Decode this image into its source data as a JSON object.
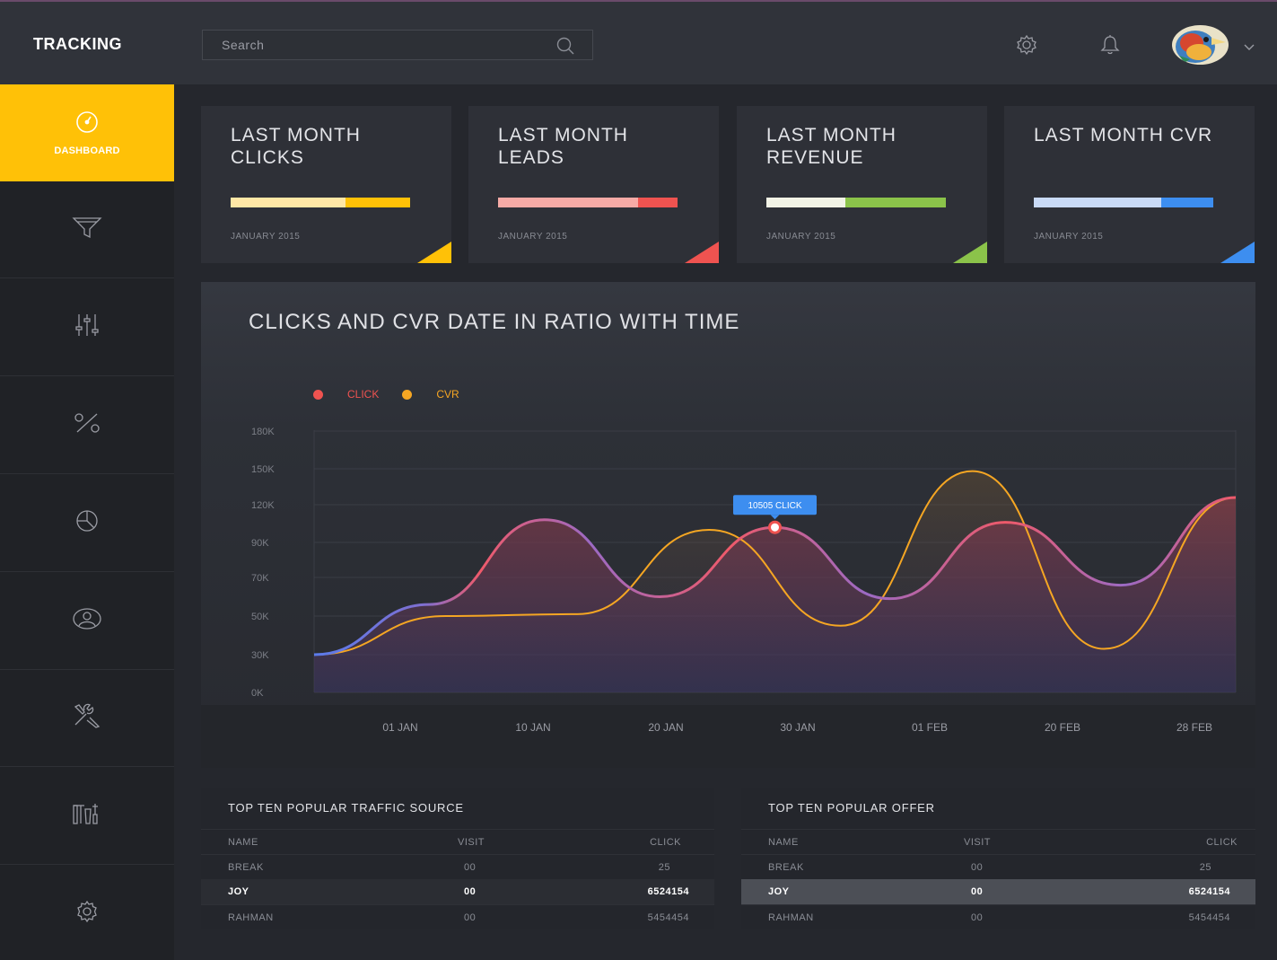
{
  "header": {
    "brand": "TRACKING",
    "search_placeholder": "Search",
    "icons": [
      "search-icon",
      "settings-icon",
      "notification-bell-icon",
      "chevron-down-icon"
    ]
  },
  "sidebar": {
    "items": [
      {
        "label": "DASHBOARD",
        "icon": "dashboard-gauge-icon",
        "active": true
      },
      {
        "label": "",
        "icon": "filter-funnel-icon"
      },
      {
        "label": "",
        "icon": "sliders-icon"
      },
      {
        "label": "",
        "icon": "percent-icon"
      },
      {
        "label": "",
        "icon": "pie-chart-icon"
      },
      {
        "label": "",
        "icon": "user-icon"
      },
      {
        "label": "",
        "icon": "tools-icon"
      },
      {
        "label": "",
        "icon": "toolkit-icon"
      },
      {
        "label": "",
        "icon": "settings-icon"
      }
    ]
  },
  "cards": [
    {
      "title": "LAST MONTH CLICKS",
      "subtitle": "JANUARY 2015",
      "progress": 0.64,
      "colors": {
        "light": "#ffe7a6",
        "main": "#ffc107"
      }
    },
    {
      "title": "LAST MONTH LEADS",
      "subtitle": "JANUARY 2015",
      "progress": 0.78,
      "colors": {
        "light": "#f6aaa6",
        "main": "#ef5350"
      }
    },
    {
      "title": "LAST MONTH REVENUE",
      "subtitle": "JANUARY 2015",
      "progress": 0.44,
      "colors": {
        "light": "#f2f3e6",
        "main": "#8bc34a"
      }
    },
    {
      "title": "LAST MONTH CVR",
      "subtitle": "JANUARY 2015",
      "progress": 0.71,
      "colors": {
        "light": "#c9daf6",
        "main": "#3d8ef0"
      }
    }
  ],
  "chart_data": {
    "type": "line",
    "title": "CLICKS AND CVR DATE IN RATIO WITH TIME",
    "x_tick_labels": [
      "01 JAN",
      "10 JAN",
      "20 JAN",
      "30 JAN",
      "01 FEB",
      "20 FEB",
      "28 FEB"
    ],
    "y_tick_labels": [
      "180K",
      "150K",
      "120K",
      "90K",
      "70K",
      "50K",
      "30K",
      "0K"
    ],
    "grid": true,
    "legend_placement": "top-left",
    "series": [
      {
        "name": "CLICK",
        "color": "#ef5350",
        "points": [
          [
            "01 JAN",
            30
          ],
          [
            "01 JAN",
            56
          ],
          [
            "10 JAN",
            108
          ],
          [
            "20 JAN",
            60
          ],
          [
            "30 JAN",
            102
          ],
          [
            "01 FEB",
            59
          ],
          [
            "20 FEB",
            106
          ],
          [
            "20 FEB",
            66
          ],
          [
            "28 FEB",
            126
          ]
        ]
      },
      {
        "name": "CVR",
        "color": "#f5a623",
        "points": [
          [
            "01 JAN",
            30
          ],
          [
            "01 JAN",
            50
          ],
          [
            "10 JAN",
            51
          ],
          [
            "20 JAN",
            100
          ],
          [
            "30 JAN",
            45
          ],
          [
            "01 FEB",
            148
          ],
          [
            "20 FEB",
            33
          ],
          [
            "28 FEB",
            126
          ]
        ]
      }
    ],
    "tooltip": "10505 CLICK"
  },
  "tables": [
    {
      "title": "TOP TEN POPULAR TRAFFIC SOURCE",
      "columns": [
        "NAME",
        "VISIT",
        "CLICK"
      ],
      "rows": [
        [
          "BREAK",
          "00",
          "25"
        ],
        [
          "JOY",
          "00",
          "6524154"
        ],
        [
          "RAHMAN",
          "00",
          "5454454"
        ]
      ]
    },
    {
      "title": "TOP TEN POPULAR OFFER",
      "columns": [
        "NAME",
        "VISIT",
        "CLICK"
      ],
      "rows": [
        [
          "BREAK",
          "00",
          "25"
        ],
        [
          "JOY",
          "00",
          "6524154"
        ],
        [
          "RAHMAN",
          "00",
          "5454454"
        ]
      ]
    }
  ]
}
